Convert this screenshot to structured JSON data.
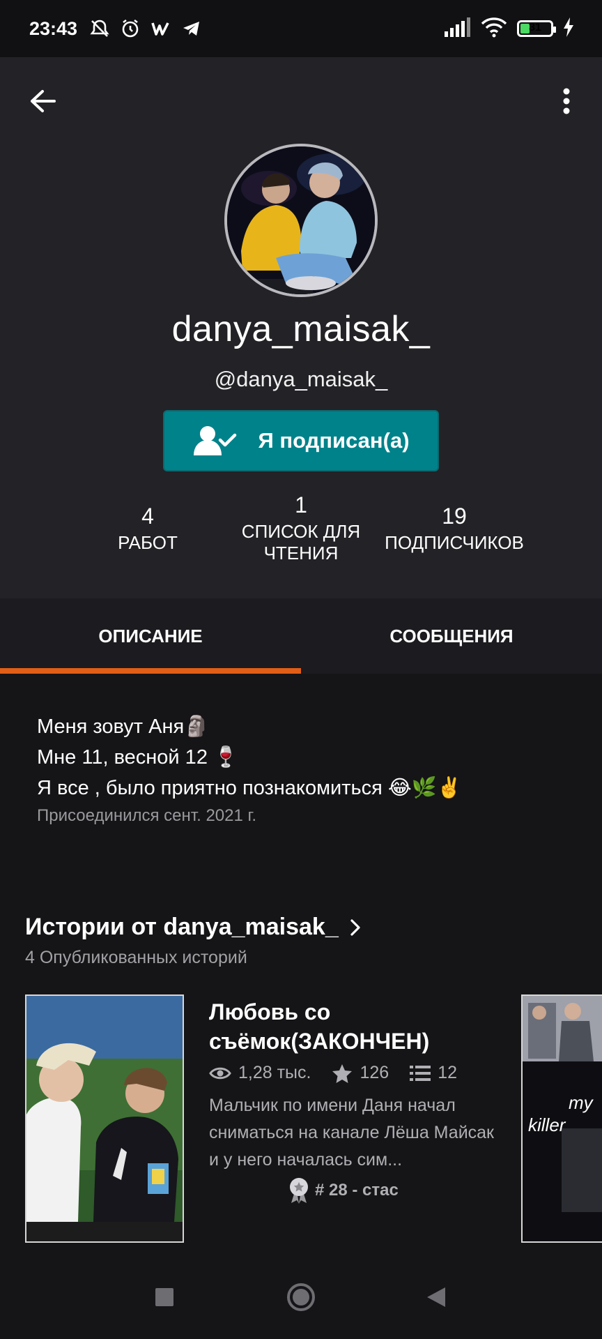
{
  "status_bar": {
    "time": "23:43",
    "battery_level": "31",
    "battery_fraction": 0.31,
    "icons": [
      "alarm-off-icon",
      "alarm-clock-icon",
      "w-app-icon",
      "telegram-icon",
      "signal-icon",
      "wifi-icon",
      "battery-icon",
      "charging-icon"
    ]
  },
  "header": {
    "username": "danya_maisak_",
    "handle": "@danya_maisak_",
    "follow_label": "Я подписан(а)",
    "accent_color": "#00828a"
  },
  "stats": [
    {
      "value": "4",
      "label": "РАБОТ"
    },
    {
      "value": "1",
      "label": "СПИСОК ДЛЯ ЧТЕНИЯ"
    },
    {
      "value": "19",
      "label": "ПОДПИСЧИКОВ"
    }
  ],
  "tabs": [
    {
      "label": "ОПИСАНИЕ",
      "active": true
    },
    {
      "label": "СООБЩЕНИЯ",
      "active": false
    }
  ],
  "tab_indicator_color": "#e15e17",
  "description": {
    "lines": [
      "Меня зовут Аня🗿",
      "Мне 11, весной 12 🍷",
      "Я все , было приятно познакомиться 😂🌿✌️"
    ],
    "joined": "Присоединился сент. 2021 г."
  },
  "stories": {
    "title": "Истории от danya_maisak_",
    "subtitle": "4 Опубликованных историй",
    "items": [
      {
        "title": "Любовь со съёмок(ЗАКОНЧЕН)",
        "reads": "1,28 тыс.",
        "votes": "126",
        "parts": "12",
        "description": "Мальчик по имени Даня начал сниматься на канале Лёша Майсак и у него началась сим...",
        "rank": "# 28 - стас"
      }
    ],
    "next_cover_text": [
      "my",
      "killer"
    ]
  },
  "nav": [
    "recent-apps-icon",
    "home-icon",
    "back-triangle-icon"
  ]
}
